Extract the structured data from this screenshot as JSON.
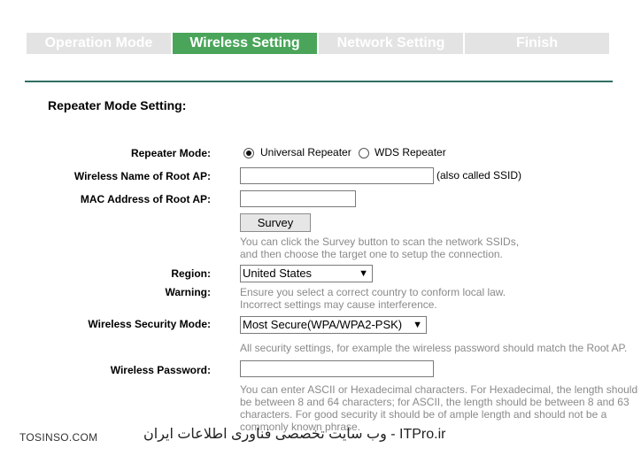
{
  "steps": [
    {
      "label": "Operation Mode",
      "active": false
    },
    {
      "label": "Wireless Setting",
      "active": true
    },
    {
      "label": "Network Setting",
      "active": false
    },
    {
      "label": "Finish",
      "active": false
    }
  ],
  "section_title": "Repeater Mode Setting:",
  "repeater_mode": {
    "label": "Repeater Mode:",
    "options": [
      "Universal Repeater",
      "WDS Repeater"
    ],
    "selected": "Universal Repeater"
  },
  "root_ap_name": {
    "label": "Wireless Name of Root AP:",
    "value": "",
    "note": "(also called SSID)"
  },
  "root_ap_mac": {
    "label": "MAC Address of Root AP:",
    "value": ""
  },
  "survey": {
    "button": "Survey",
    "help_line1": "You can click the Survey button to scan the network SSIDs,",
    "help_line2": "and then choose the target one to setup the connection."
  },
  "region": {
    "label": "Region:",
    "value": "United States"
  },
  "warning": {
    "label": "Warning:",
    "line1": "Ensure you select a correct country to conform local law.",
    "line2": "Incorrect settings may cause interference."
  },
  "security": {
    "label": "Wireless Security Mode:",
    "value": "Most Secure(WPA/WPA2-PSK)",
    "help": "All security settings, for example the wireless password should match the Root AP."
  },
  "password": {
    "label": "Wireless Password:",
    "value": "",
    "help_line1": "You can enter ASCII or Hexadecimal characters. For Hexadecimal, the length should",
    "help_line2": "be between 8 and 64 characters; for ASCII, the length should be between 8 and 63",
    "help_line3": "characters. For good security it should be of ample length and should not be a",
    "help_line4": "commonly known phrase."
  },
  "watermarks": {
    "left": "TOSINSO.COM",
    "right": "وب سایت تخصصی فناوری اطلاعات ایران - ITPro.ir"
  },
  "colors": {
    "active_step": "#4aa55b",
    "inactive_step": "#e3e3e3",
    "rule": "#2f6f63",
    "help_text": "#8a8a8a"
  }
}
